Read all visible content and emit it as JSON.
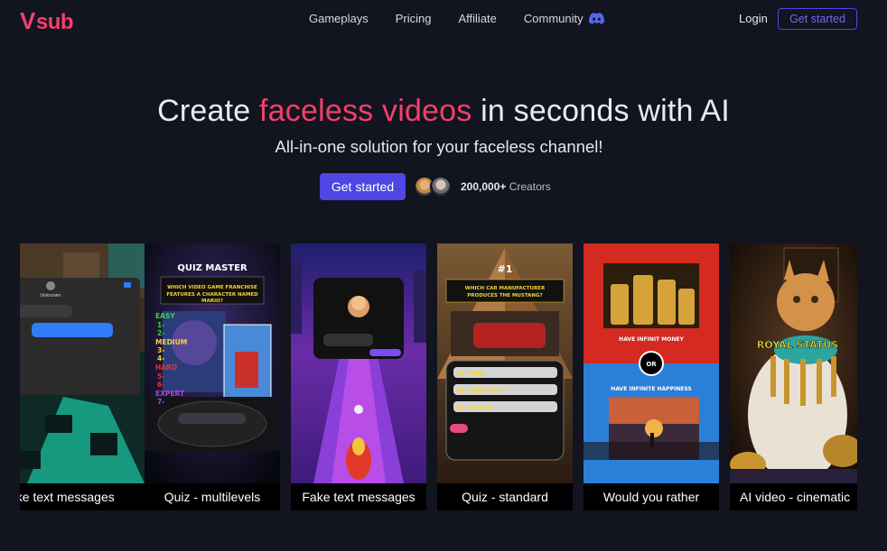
{
  "brand": {
    "logo_v": "V",
    "logo_text": "sub",
    "color": "#f43f6e"
  },
  "nav": {
    "links": [
      "Gameplays",
      "Pricing",
      "Affiliate",
      "Community"
    ],
    "login": "Login",
    "get_started": "Get started"
  },
  "hero": {
    "title_pre": "Create ",
    "title_accent": "faceless videos",
    "title_post": " in seconds with AI",
    "subtitle": "All-in-one solution for your faceless channel!",
    "cta": "Get started",
    "creators_count": "200,000+",
    "creators_label": " Creators"
  },
  "cards": [
    {
      "caption": "ake text messages",
      "phone_name": "Unknown"
    },
    {
      "caption": "Quiz - multilevels",
      "title": "QUIZ MASTER",
      "question": "WHICH VIDEO GAME FRANCHISE FEATURES A CHARACTER NAMED MARIO?",
      "levels": [
        "EASY",
        "1-",
        "2-",
        "MEDIUM",
        "3-",
        "4-",
        "HARD",
        "5-",
        "6-",
        "EXPERT",
        "7-"
      ]
    },
    {
      "caption": "Fake text messages"
    },
    {
      "caption": "Quiz - standard",
      "number": "#1",
      "question": "WHICH CAR MANUFACTURER PRODUCES THE MUSTANG?",
      "answers": [
        "A) FORD",
        "B) CHEVROLET",
        "C) TOYOTA"
      ]
    },
    {
      "caption": "Would you rather",
      "top": "HAVE INFINIT MONEY",
      "or": "OR",
      "bottom": "HAVE INFINITE HAPPINESS"
    },
    {
      "caption": "AI video - cinematic",
      "label": "ROYAL STATUS"
    }
  ],
  "colors": {
    "accent": "#f43f6e",
    "primary": "#4f46e5",
    "background": "#12141f"
  },
  "icons": {
    "community": "discord-icon"
  }
}
